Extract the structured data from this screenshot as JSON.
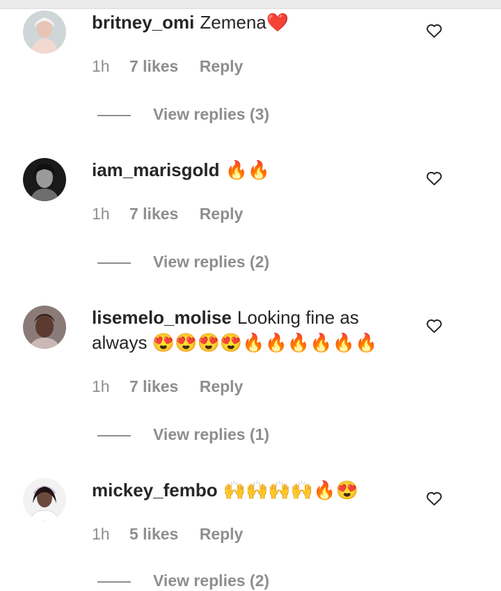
{
  "comments": [
    {
      "username": "britney_omi",
      "text": "Zemena❤️",
      "time": "1h",
      "likes": "7 likes",
      "reply": "Reply",
      "view_replies": "View replies (3)"
    },
    {
      "username": "iam_marisgold",
      "text": "🔥🔥",
      "time": "1h",
      "likes": "7 likes",
      "reply": "Reply",
      "view_replies": "View replies (2)"
    },
    {
      "username": "lisemelo_molise",
      "text": "Looking fine as always 😍😍😍😍🔥🔥🔥🔥🔥🔥",
      "time": "1h",
      "likes": "7 likes",
      "reply": "Reply",
      "view_replies": "View replies (1)"
    },
    {
      "username": "mickey_fembo",
      "text": "🙌🙌🙌🙌🔥😍",
      "time": "1h",
      "likes": "5 likes",
      "reply": "Reply",
      "view_replies": "View replies (2)"
    }
  ],
  "icons": {
    "like": "heart-outline-icon",
    "avatar": "profile-photo"
  },
  "colors": {
    "primary_text": "#262626",
    "secondary_text": "#8e8e8e",
    "background": "#ffffff"
  }
}
